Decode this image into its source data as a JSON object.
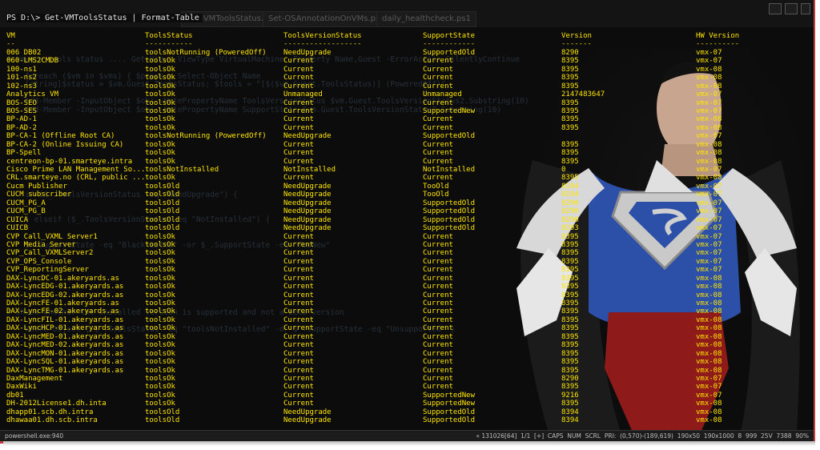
{
  "prompt": "PS D:\\> Get-VMToolsStatus | Format-Table",
  "tabs": [
    {
      "label": "Get-VMToolsStatus.ps1*"
    },
    {
      "label": "Set-OSAnnotationOnVMs.ps1"
    },
    {
      "label": "daily_healthcheck.ps1"
    }
  ],
  "ghost_lines": [
    "# vmware tools status .... Get-View -ViewType VirtualMachine -Property Name,Guest -ErrorAction SilentlyContinue",
    "    foreach ($vm in $vms) { $props = Select-Object Name",
    "    [string]$status = $vm.Guest.ToolsStatus; $tools = \"[$($vm.Guest.ToolsStatus)] (PoweredOff)\"",
    "    Add-Member -InputObject $obj -NotePropertyName ToolsVersionStatus $vm.Guest.ToolsVersionStatus2.Substring(10)",
    "    Add-Member -InputObject $obj -NotePropertyName SupportState $vm.Guest.ToolsVersionStatus2.Substring(10)",
    "    if ($_.ToolsVersionStatus -eq \"NeedUpgrade\") {",
    "    } elseif ($_.ToolsVersionStatus -eq \"NotInstalled\") {",
    "    $_.SupportState -eq \"Blacklisted\" -or $_.SupportState -eq \"TooNew\"",
    "# Check whether the installed version is supported and not a beta version",
    "    Where-Object { $_.ToolsStatus -eq \"toolsNotInstalled\" -or $_.SupportState -eq \"Unsupported\" }"
  ],
  "columns": [
    "VM",
    "ToolsStatus",
    "ToolsVersionStatus",
    "SupportState",
    "Version",
    "HW Version"
  ],
  "separators": [
    "--",
    "-----------",
    "------------------",
    "------------",
    "-------",
    "----------"
  ],
  "rows": [
    [
      "006 DB02",
      "toolsNotRunning (PoweredOff)",
      "NeedUpgrade",
      "SupportedOld",
      "8290",
      "vmx-07"
    ],
    [
      "060-LMS2CMDB",
      "toolsOk",
      "Current",
      "Current",
      "8395",
      "vmx-07"
    ],
    [
      "100-ns1",
      "toolsOk",
      "Current",
      "Current",
      "8395",
      "vmx-08"
    ],
    [
      "101-ns2",
      "toolsOk",
      "Current",
      "Current",
      "8395",
      "vmx-08"
    ],
    [
      "102-ns3",
      "toolsOk",
      "Current",
      "Current",
      "8395",
      "vmx-08"
    ],
    [
      "Analytics VM",
      "toolsOk",
      "Unmanaged",
      "Unmanaged",
      "2147483647",
      "vmx-07"
    ],
    [
      "BOS-SEO",
      "toolsOk",
      "Current",
      "Current",
      "8395",
      "vmx-07"
    ],
    [
      "BOS-SES",
      "toolsOk",
      "Current",
      "SupportedNew",
      "8395",
      "vmx-07"
    ],
    [
      "BP-AD-1",
      "toolsOk",
      "Current",
      "Current",
      "8395",
      "vmx-08"
    ],
    [
      "BP-AD-2",
      "toolsOk",
      "Current",
      "Current",
      "8395",
      "vmx-08"
    ],
    [
      "BP-CA-1 (Offline Root CA)",
      "toolsNotRunning (PoweredOff)",
      "NeedUpgrade",
      "SupportedOld",
      "",
      "vmx-07"
    ],
    [
      "BP-CA-2 (Online Issuing CA)",
      "toolsOk",
      "Current",
      "Current",
      "8395",
      "vmx-08"
    ],
    [
      "BP-Spell",
      "toolsOk",
      "Current",
      "Current",
      "8395",
      "vmx-08"
    ],
    [
      "centreon-bp-01.smarteye.intra",
      "toolsOk",
      "Current",
      "Current",
      "8395",
      "vmx-08"
    ],
    [
      "Cisco Prime LAN Management So...",
      "toolsNotInstalled",
      "NotInstalled",
      "NotInstalled",
      "0",
      "vmx-07"
    ],
    [
      "CRL.smarteye.no (CRL, public ...",
      "toolsOk",
      "Current",
      "Current",
      "8395",
      "vmx-08"
    ],
    [
      "Cucm Publisher",
      "toolsOld",
      "NeedUpgrade",
      "TooOld",
      "8194",
      "vmx-07"
    ],
    [
      "CUCM subscriber",
      "toolsOld",
      "NeedUpgrade",
      "TooOld",
      "8194",
      "vmx-07"
    ],
    [
      "CUCM_PG_A",
      "toolsOld",
      "NeedUpgrade",
      "SupportedOld",
      "8290",
      "vmx-07"
    ],
    [
      "CUCM_PG_B",
      "toolsOld",
      "NeedUpgrade",
      "SupportedOld",
      "8290",
      "vmx-07"
    ],
    [
      "CUICA",
      "toolsOld",
      "NeedUpgrade",
      "SupportedOld",
      "8290",
      "vmx-07"
    ],
    [
      "CUICB",
      "toolsOld",
      "NeedUpgrade",
      "SupportedOld",
      "8293",
      "vmx-07"
    ],
    [
      "CVP Call_VXML Server1",
      "toolsOk",
      "Current",
      "Current",
      "8395",
      "vmx-07"
    ],
    [
      "CVP Media Server",
      "toolsOk",
      "Current",
      "Current",
      "8395",
      "vmx-07"
    ],
    [
      "CVP_Call_VXMLServer2",
      "toolsOk",
      "Current",
      "Current",
      "8395",
      "vmx-07"
    ],
    [
      "CVP_OPS_Console",
      "toolsOk",
      "Current",
      "Current",
      "8395",
      "vmx-07"
    ],
    [
      "CVP_ReportingServer",
      "toolsOk",
      "Current",
      "Current",
      "8395",
      "vmx-07"
    ],
    [
      "DAX-LyncDC-01.akeryards.as",
      "toolsOk",
      "Current",
      "Current",
      "8395",
      "vmx-08"
    ],
    [
      "DAX-LyncEDG-01.akeryards.as",
      "toolsOk",
      "Current",
      "Current",
      "8395",
      "vmx-08"
    ],
    [
      "DAX-LyncEDG-02.akeryards.as",
      "toolsOk",
      "Current",
      "Current",
      "8395",
      "vmx-08"
    ],
    [
      "DAX-LyncFE-01.akeryards.as",
      "toolsOk",
      "Current",
      "Current",
      "8395",
      "vmx-08"
    ],
    [
      "DAX-LyncFE-02.akeryards.as",
      "toolsOk",
      "Current",
      "Current",
      "8395",
      "vmx-08"
    ],
    [
      "DAX-LyncFIL-01.akeryards.as",
      "toolsOk",
      "Current",
      "Current",
      "8395",
      "vmx-08"
    ],
    [
      "DAX-LyncHCP-01.akeryards.as",
      "toolsOk",
      "Current",
      "Current",
      "8395",
      "vmx-08"
    ],
    [
      "DAX-LyncMED-01.akeryards.as",
      "toolsOk",
      "Current",
      "Current",
      "8395",
      "vmx-08"
    ],
    [
      "DAX-LyncMED-02.akeryards.as",
      "toolsOk",
      "Current",
      "Current",
      "8395",
      "vmx-08"
    ],
    [
      "DAX-LyncMON-01.akeryards.as",
      "toolsOk",
      "Current",
      "Current",
      "8395",
      "vmx-08"
    ],
    [
      "DAX-LyncSQL-01.akeryards.as",
      "toolsOk",
      "Current",
      "Current",
      "8395",
      "vmx-08"
    ],
    [
      "DAX-LyncTMG-01.akeryards.as",
      "toolsOk",
      "Current",
      "Current",
      "8395",
      "vmx-08"
    ],
    [
      "DaxManagement",
      "toolsOk",
      "Current",
      "Current",
      "8290",
      "vmx-07"
    ],
    [
      "DaxWiki",
      "toolsOk",
      "Current",
      "Current",
      "8395",
      "vmx-07"
    ],
    [
      "db01",
      "toolsOk",
      "Current",
      "SupportedNew",
      "9216",
      "vmx-07"
    ],
    [
      "DH-2012License1.dh.inta",
      "toolsOk",
      "Current",
      "SupportedNew",
      "8395",
      "vmx-08"
    ],
    [
      "dhapp01.scb.dh.intra",
      "toolsOld",
      "NeedUpgrade",
      "SupportedOld",
      "8394",
      "vmx-08"
    ],
    [
      "dhawaa01.dh.scb.intra",
      "toolsOld",
      "NeedUpgrade",
      "SupportedOld",
      "8394",
      "vmx-08"
    ]
  ],
  "statusbar": {
    "left": "powershell.exe:940",
    "right": "« 131026[64]  1/1  [+]  CAPS  NUM  SCRL  PRI:  (0,570)-(189,619)  190x50  190x1000  8  999  25V  7388  90%"
  },
  "colors": {
    "background": "#0c0c0c",
    "text_yellow": "#ffe600",
    "frame_border": "#c23b3b",
    "hero_suit": "#2c4fa8",
    "hero_cape": "#8e1a1a"
  },
  "illustration": "superman-opening-shirt"
}
